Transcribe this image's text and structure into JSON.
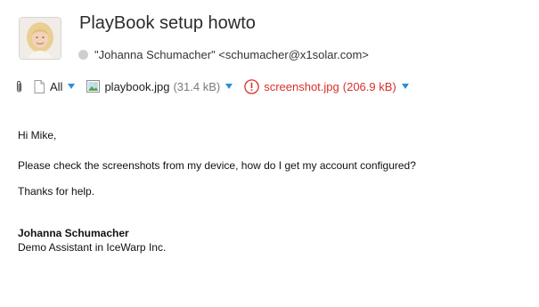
{
  "message": {
    "subject": "PlayBook setup howto",
    "sender": {
      "display": "\"Johanna Schumacher\" <schumacher@x1solar.com>",
      "presence": "offline"
    }
  },
  "attachments": {
    "all_label": "All",
    "items": [
      {
        "icon": "image-file-icon",
        "name": "playbook.jpg",
        "size": "(31.4 kB)",
        "status": "ok"
      },
      {
        "icon": "error-icon",
        "name": "screenshot.jpg",
        "size": "(206.9 kB)",
        "status": "error"
      }
    ]
  },
  "body": {
    "greeting": "Hi Mike,",
    "paragraph": "Please check the screenshots from my device, how do I get my account configured?",
    "closing": "Thanks for help.",
    "signature_name": "Johanna Schumacher",
    "signature_title": "Demo Assistant in IceWarp Inc."
  },
  "colors": {
    "accent": "#2a8fd8",
    "error": "#d9302a",
    "muted": "#7a7a7a"
  }
}
